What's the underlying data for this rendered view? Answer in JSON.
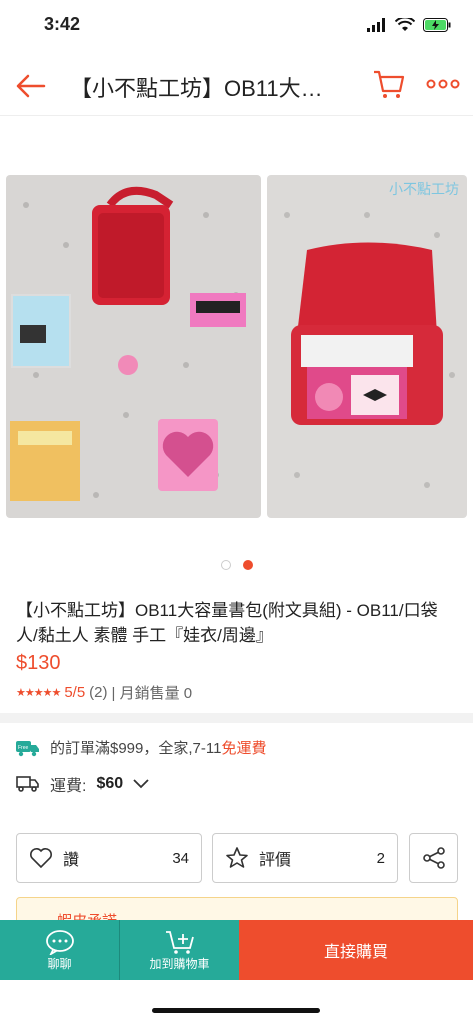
{
  "status": {
    "time": "3:42"
  },
  "header": {
    "title": "【小不點工坊】OB11大…",
    "back_icon": "back-arrow-icon",
    "cart_icon": "cart-icon",
    "more_icon": "more-icon",
    "accent": "#ee4d2d"
  },
  "gallery": {
    "watermark": "小不點工坊",
    "page_count": 2,
    "active_index": 2
  },
  "product": {
    "title": "【小不點工坊】OB11大容量書包(附文具組) - OB11/口袋人/黏土人 素體 手工『娃衣/周邊』",
    "price": "$130",
    "rating_stars": 5,
    "rating": "5/5",
    "rating_count": "(2)",
    "sold_label": "| 月銷售量 0"
  },
  "shipping": {
    "free_text": "的訂單滿$999，全家,7-11",
    "free_tag": "免運費",
    "fee_label": "運費:",
    "fee_value": "$60"
  },
  "actions": {
    "like_label": "讚",
    "like_count": "34",
    "review_label": "評價",
    "review_count": "2"
  },
  "promise": {
    "label": "蝦皮承諾"
  },
  "bottom": {
    "chat_label": "聊聊",
    "addcart_label": "加到購物車",
    "buy_label": "直接購買",
    "teal": "#26aa99"
  }
}
